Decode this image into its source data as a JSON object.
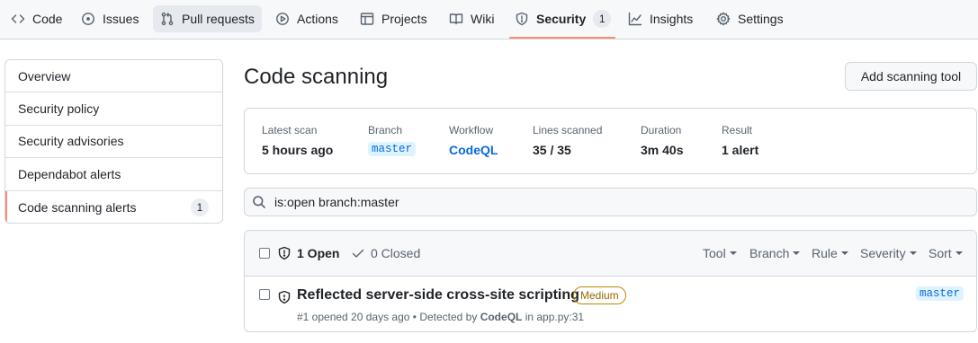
{
  "nav": {
    "tabs": [
      {
        "label": "Code",
        "icon": "code-icon"
      },
      {
        "label": "Issues",
        "icon": "issue-icon"
      },
      {
        "label": "Pull requests",
        "icon": "pull-request-icon"
      },
      {
        "label": "Actions",
        "icon": "play-icon"
      },
      {
        "label": "Projects",
        "icon": "table-icon"
      },
      {
        "label": "Wiki",
        "icon": "book-icon"
      },
      {
        "label": "Security",
        "icon": "shield-icon",
        "counter": "1",
        "selected": true
      },
      {
        "label": "Insights",
        "icon": "graph-icon"
      },
      {
        "label": "Settings",
        "icon": "gear-icon"
      }
    ],
    "underline_color": "#fd8c73"
  },
  "sidebar": {
    "items": [
      {
        "label": "Overview"
      },
      {
        "label": "Security policy"
      },
      {
        "label": "Security advisories"
      },
      {
        "label": "Dependabot alerts"
      },
      {
        "label": "Code scanning alerts",
        "counter": "1",
        "selected": true
      }
    ]
  },
  "main": {
    "title": "Code scanning",
    "add_tool_label": "Add scanning tool",
    "summary": {
      "latest_scan": {
        "label": "Latest scan",
        "value": "5 hours ago"
      },
      "branch": {
        "label": "Branch",
        "value": "master"
      },
      "workflow": {
        "label": "Workflow",
        "value": "CodeQL"
      },
      "lines_scanned": {
        "label": "Lines scanned",
        "value": "35 / 35"
      },
      "duration": {
        "label": "Duration",
        "value": "3m 40s"
      },
      "result": {
        "label": "Result",
        "value": "1 alert"
      }
    },
    "search": {
      "query": "is:open branch:master"
    },
    "results": {
      "open_label": "1 Open",
      "closed_label": "0 Closed",
      "filters": [
        "Tool",
        "Branch",
        "Rule",
        "Severity",
        "Sort"
      ],
      "alerts": [
        {
          "title": "Reflected server-side cross-site scripting",
          "severity": "Medium",
          "meta_prefix": "#1 opened 20 days ago • Detected by ",
          "tool": "CodeQL",
          "meta_location": " in app.py:31",
          "branch": "master"
        }
      ]
    }
  }
}
